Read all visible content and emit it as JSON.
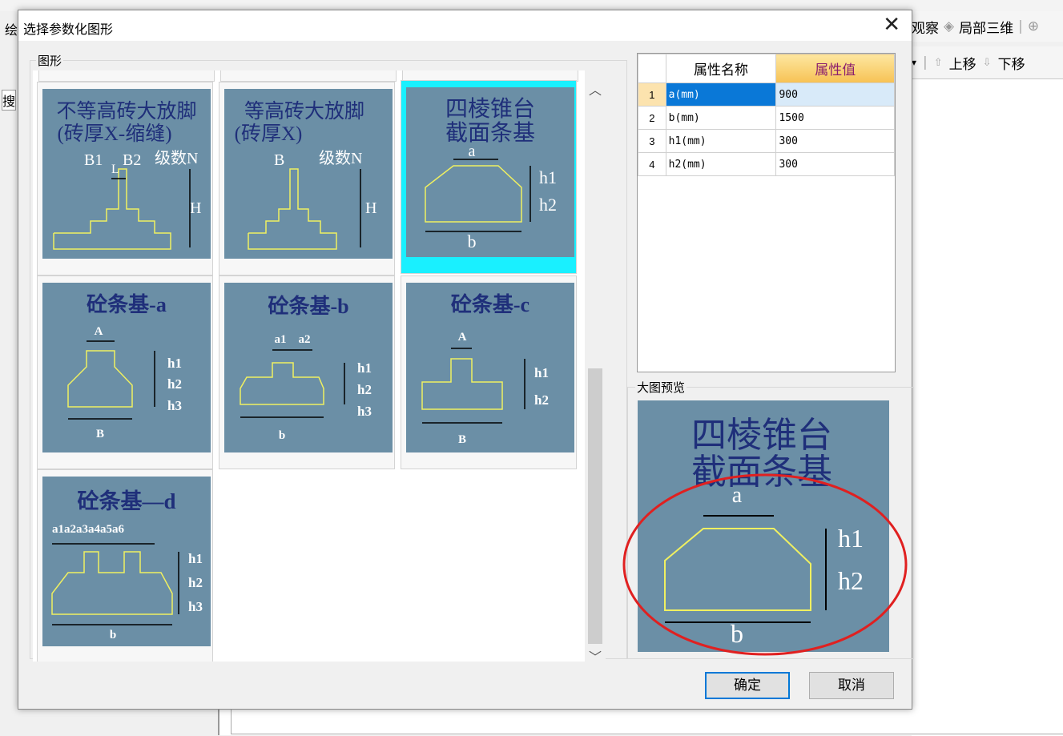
{
  "background_app": {
    "left_glyph": "绘",
    "toolbar_top": [
      {
        "label": "观察"
      },
      {
        "label": "局部三维"
      }
    ],
    "toolbar_second": [
      {
        "label": "上移"
      },
      {
        "label": "下移"
      }
    ],
    "search_stub": "搜"
  },
  "dialog": {
    "title": "选择参数化图形",
    "close_glyph": "✕",
    "shapes_group_label": "图形",
    "preview_group_label": "大图预览",
    "ok_label": "确定",
    "cancel_label": "取消"
  },
  "shapes": [
    {
      "title1": "不等高砖大放脚",
      "title2": "(砖厚X-缩缝)",
      "labels": [
        "B1",
        "L",
        "B2",
        "级数N",
        "H"
      ]
    },
    {
      "title1": "等高砖大放脚",
      "title2": "(砖厚X)",
      "labels": [
        "B",
        "级数N",
        "H"
      ]
    },
    {
      "title1": "四棱锥台",
      "title2": "截面条基",
      "labels": [
        "a",
        "h1",
        "h2",
        "b"
      ],
      "selected": true
    },
    {
      "title1": "砼条基-a",
      "labels": [
        "A",
        "h1",
        "h2",
        "h3",
        "B"
      ]
    },
    {
      "title1": "砼条基-b",
      "labels": [
        "a1",
        "a2",
        "h1",
        "h2",
        "h3",
        "b"
      ]
    },
    {
      "title1": "砼条基-c",
      "labels": [
        "A",
        "h1",
        "h2",
        "B"
      ]
    },
    {
      "title1": "砼条基—d",
      "labels": [
        "a1a2a3a4a5a6",
        "h1",
        "h2",
        "h3",
        "b"
      ]
    }
  ],
  "properties": {
    "header_name": "属性名称",
    "header_value": "属性值",
    "rows": [
      {
        "idx": "1",
        "name": "a(mm)",
        "value": "900"
      },
      {
        "idx": "2",
        "name": "b(mm)",
        "value": "1500"
      },
      {
        "idx": "3",
        "name": "h1(mm)",
        "value": "300"
      },
      {
        "idx": "4",
        "name": "h2(mm)",
        "value": "300"
      }
    ]
  },
  "preview": {
    "title1": "四棱锥台",
    "title2": "截面条基",
    "labels": [
      "a",
      "h1",
      "h2",
      "b"
    ]
  },
  "colors": {
    "tile_bg": "#6b8fa6",
    "shape_line": "#f0f060",
    "title_text": "#1f2f7a",
    "selection": "#19f0ff",
    "annotation": "#e02020"
  }
}
